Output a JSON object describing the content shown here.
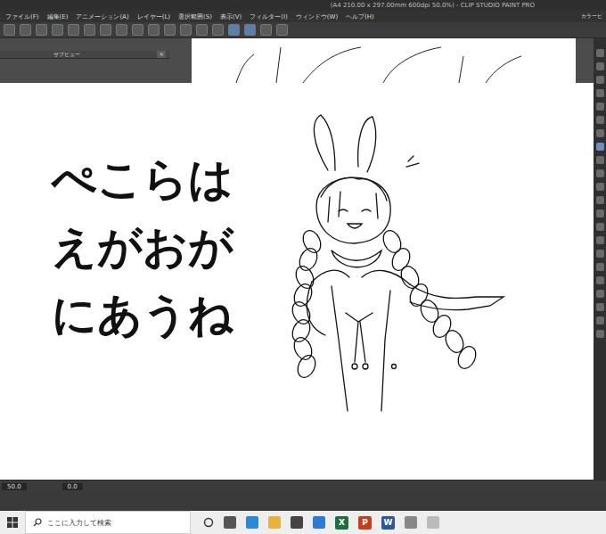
{
  "window": {
    "title": "(A4 210.00 x 297.00mm 600dpi 50.0%) - CLIP STUDIO PAINT PRO"
  },
  "menu": [
    "ファイル(F)",
    "編集(E)",
    "アニメーション(A)",
    "レイヤー(L)",
    "選択範囲(S)",
    "表示(V)",
    "フィルター(I)",
    "ウィンドウ(W)",
    "ヘルプ(H)"
  ],
  "panels": {
    "subview": "サブビュー",
    "subview_close": "×",
    "color": "カラービ"
  },
  "canvas": {
    "text_lines": [
      "ぺこらは",
      "えがおが",
      "にあうね"
    ]
  },
  "status_bar": {
    "zoom": "50.0",
    "rotation": "0.0"
  },
  "taskbar": {
    "search_placeholder": "ここに入力して検索",
    "apps": [
      {
        "label": "X",
        "color": "#1d6f42"
      },
      {
        "label": "P",
        "color": "#c43e1c"
      },
      {
        "label": "W",
        "color": "#2b579a"
      }
    ]
  }
}
